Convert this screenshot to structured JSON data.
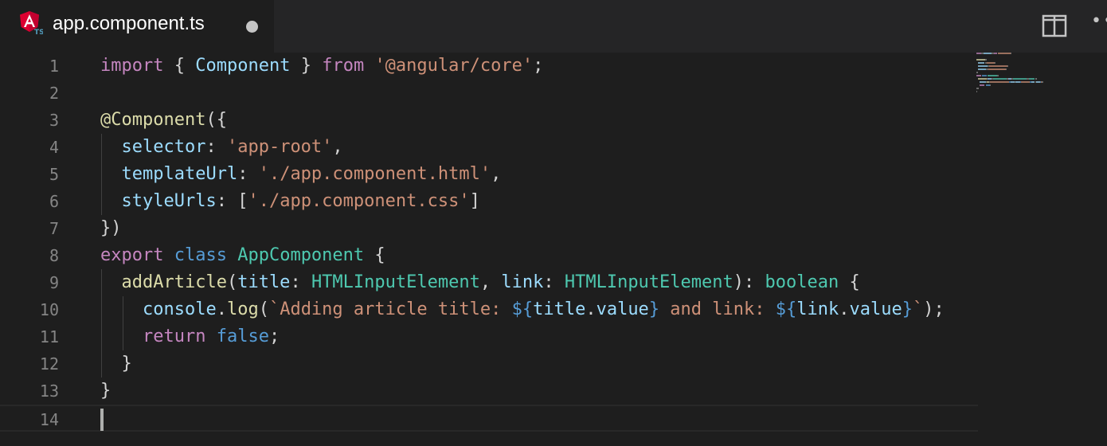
{
  "tab": {
    "title": "app.component.ts",
    "icon": "angular-typescript-icon",
    "icon_badge": "TS",
    "modified": true
  },
  "actions": {
    "split_icon": "split-editor-icon",
    "more_icon": "more-actions-icon",
    "more_label": "••"
  },
  "colors": {
    "keyword": "#c586c0",
    "keyword_blue": "#569cd6",
    "string": "#ce9178",
    "property": "#9cdcfe",
    "function": "#dcdcaa",
    "type": "#4ec9b0",
    "text": "#d4d4d4",
    "line_number": "#858585",
    "background": "#1e1e1e"
  },
  "editor": {
    "current_line": 14,
    "lines": [
      {
        "n": "1",
        "tokens": [
          {
            "t": "import",
            "c": "kw"
          },
          {
            "t": " { "
          },
          {
            "t": "Component",
            "c": "prop"
          },
          {
            "t": " } "
          },
          {
            "t": "from",
            "c": "kw"
          },
          {
            "t": " "
          },
          {
            "t": "'@angular/core'",
            "c": "str"
          },
          {
            "t": ";"
          }
        ]
      },
      {
        "n": "2",
        "tokens": []
      },
      {
        "n": "3",
        "tokens": [
          {
            "t": "@Component",
            "c": "fn"
          },
          {
            "t": "({"
          }
        ]
      },
      {
        "n": "4",
        "tokens": [
          {
            "t": "  "
          },
          {
            "t": "selector",
            "c": "prop"
          },
          {
            "t": ": "
          },
          {
            "t": "'app-root'",
            "c": "str"
          },
          {
            "t": ","
          }
        ]
      },
      {
        "n": "5",
        "tokens": [
          {
            "t": "  "
          },
          {
            "t": "templateUrl",
            "c": "prop"
          },
          {
            "t": ": "
          },
          {
            "t": "'./app.component.html'",
            "c": "str"
          },
          {
            "t": ","
          }
        ]
      },
      {
        "n": "6",
        "tokens": [
          {
            "t": "  "
          },
          {
            "t": "styleUrls",
            "c": "prop"
          },
          {
            "t": ": ["
          },
          {
            "t": "'./app.component.css'",
            "c": "str"
          },
          {
            "t": "]"
          }
        ]
      },
      {
        "n": "7",
        "tokens": [
          {
            "t": "})"
          }
        ]
      },
      {
        "n": "8",
        "tokens": [
          {
            "t": "export",
            "c": "kw"
          },
          {
            "t": " "
          },
          {
            "t": "class",
            "c": "kwb"
          },
          {
            "t": " "
          },
          {
            "t": "AppComponent",
            "c": "type"
          },
          {
            "t": " {"
          }
        ]
      },
      {
        "n": "9",
        "tokens": [
          {
            "t": "  "
          },
          {
            "t": "addArticle",
            "c": "fn"
          },
          {
            "t": "("
          },
          {
            "t": "title",
            "c": "prop"
          },
          {
            "t": ": "
          },
          {
            "t": "HTMLInputElement",
            "c": "type"
          },
          {
            "t": ", "
          },
          {
            "t": "link",
            "c": "prop"
          },
          {
            "t": ": "
          },
          {
            "t": "HTMLInputElement",
            "c": "type"
          },
          {
            "t": "): "
          },
          {
            "t": "boolean",
            "c": "type"
          },
          {
            "t": " {"
          }
        ]
      },
      {
        "n": "10",
        "tokens": [
          {
            "t": "    "
          },
          {
            "t": "console",
            "c": "prop"
          },
          {
            "t": "."
          },
          {
            "t": "log",
            "c": "fn"
          },
          {
            "t": "("
          },
          {
            "t": "`Adding article title: ",
            "c": "str"
          },
          {
            "t": "${",
            "c": "kwb"
          },
          {
            "t": "title",
            "c": "prop"
          },
          {
            "t": "."
          },
          {
            "t": "value",
            "c": "prop"
          },
          {
            "t": "}",
            "c": "kwb"
          },
          {
            "t": " and link: ",
            "c": "str"
          },
          {
            "t": "${",
            "c": "kwb"
          },
          {
            "t": "link",
            "c": "prop"
          },
          {
            "t": "."
          },
          {
            "t": "value",
            "c": "prop"
          },
          {
            "t": "}",
            "c": "kwb"
          },
          {
            "t": "`",
            "c": "str"
          },
          {
            "t": ");"
          }
        ]
      },
      {
        "n": "11",
        "tokens": [
          {
            "t": "    "
          },
          {
            "t": "return",
            "c": "kw"
          },
          {
            "t": " "
          },
          {
            "t": "false",
            "c": "kwb"
          },
          {
            "t": ";"
          }
        ]
      },
      {
        "n": "12",
        "tokens": [
          {
            "t": "  }"
          }
        ]
      },
      {
        "n": "13",
        "tokens": [
          {
            "t": "}"
          }
        ]
      },
      {
        "n": "14",
        "tokens": []
      }
    ]
  }
}
